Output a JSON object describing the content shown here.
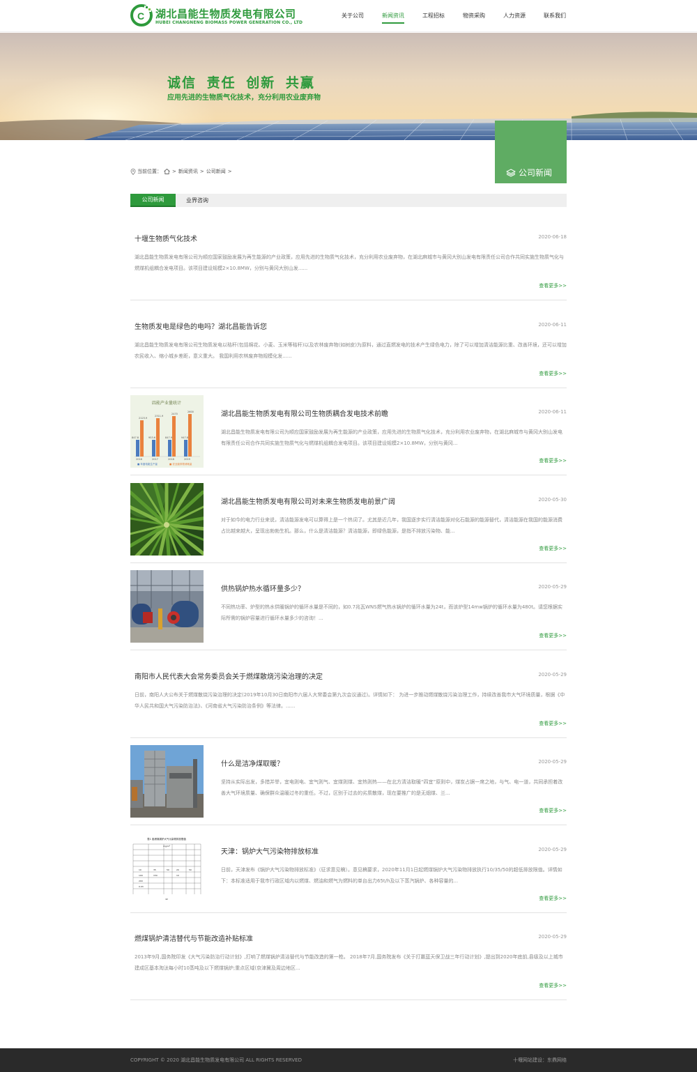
{
  "header": {
    "company_cn": "湖北昌能生物质发电有限公司",
    "company_en": "HUBEI CHANGNENG BIOMASS POWER GENERATION CO., LTD",
    "nav": [
      {
        "label": "关于公司",
        "active": false
      },
      {
        "label": "新闻资讯",
        "active": true
      },
      {
        "label": "工程招标",
        "active": false
      },
      {
        "label": "物资采购",
        "active": false
      },
      {
        "label": "人力资源",
        "active": false
      },
      {
        "label": "联系我们",
        "active": false
      }
    ]
  },
  "banner": {
    "slogan": "诚信 责任 创新 共赢",
    "subslogan": "应用先进的生物质气化技术，充分利用农业废弃物"
  },
  "section_badge": "公司新闻",
  "breadcrumb": {
    "prefix": "当前位置：",
    "sep": ">",
    "items": [
      "新闻资讯",
      "公司新闻"
    ]
  },
  "tabs": [
    {
      "label": "公司新闻",
      "active": true
    },
    {
      "label": "业界咨询",
      "active": false
    }
  ],
  "thumb_chart": {
    "title": "四能产业量统计",
    "series_a": [
      "2019",
      "2018",
      "2017",
      "2016"
    ],
    "labels": [
      "2123.9",
      "2311.9",
      "2470",
      "2600",
      "847.8",
      "953.6",
      "847.9",
      "947.8"
    ],
    "legend": [
      "■ 年度电能生产量",
      "■ 农业废弃物消耗量"
    ]
  },
  "thumb_table": {
    "title": "表1 各燃煤锅炉大气污染物排放限值",
    "unit": "mg/m³",
    "cell_values": [
      "10",
      "35",
      "50",
      "100",
      "150",
      "200",
      "0.03",
      "20",
      "10",
      "50"
    ]
  },
  "news": [
    {
      "title": "十堰生物质气化技术",
      "date": "2020-06-18",
      "desc": "湖北昌能生物质发电有限公司为顺应国家鼓励发展为再生能源的产业政策，应用先进的生物质气化技术，充分利用农业废弃物，在湖北麻城市与黄冈大别山发电有限责任公司合作共同实施生物质气化与燃煤机组耦合发电项目。该项目建设规模2×10.8MW，分别与黄冈大别山发......",
      "more": "查看更多>>",
      "thumb": null
    },
    {
      "title": "生物质发电是绿色的电吗？湖北昌能告诉您",
      "date": "2020-06-11",
      "desc": "湖北昌能生物质发电有限公司生物质发电以秸秆(包括棉花、小麦、玉米等秸秆)以及农林废弃物(如树皮)为原料，通过直燃发电的技术产生绿色电力，除了可以增加清洁能源比重、改善环境，还可以增加农民收入、缩小城乡差距，意义重大。 我国利用农林废弃物规模化发......",
      "more": "查看更多>>",
      "thumb": null
    },
    {
      "title": "湖北昌能生物质发电有限公司生物质耦合发电技术前瞻",
      "date": "2020-06-11",
      "desc": "湖北昌能生物质发电有限公司为顺应国家鼓励发展为再生能源的产业政策，应用先进的生物质气化技术，充分利用农业废弃物，在湖北麻城市与黄冈大别山发电有限责任公司合作共同实施生物质气化与燃煤机组耦合发电项目。该项目建设规模2×10.8MW，分别与黄冈...",
      "more": "查看更多>>",
      "thumb": "chart"
    },
    {
      "title": "湖北昌能生物质发电有限公司对未来生物质发电前景广阔",
      "date": "2020-05-30",
      "desc": "对于如今的电力行业来说，清洁能源发电可以算得上是一个热词了。尤其是近几年，我国逐步实行清洁能源对化石能源的能源替代，清洁能源在我国的能源消费占比越来越大，呈现出勃勃生机。那么，什么是清洁能源？清洁能源，即绿色能源，是指不排放污染物、能...",
      "more": "查看更多>>",
      "thumb": "palm"
    },
    {
      "title": "供热锅炉热水循环量多少？",
      "date": "2020-05-29",
      "desc": "不同热功率、炉型的热水供暖锅炉的循环水量是不同的，如0.7兆瓦WNS燃气热水锅炉的循环水量为24t，而该炉型14mw锅炉的循环水量为480t。请您根据实际所需的锅炉容量进行循环水量多少的咨询！...",
      "more": "查看更多>>",
      "thumb": "boiler"
    },
    {
      "title": "南阳市人民代表大会常务委员会关于燃煤散烧污染治理的决定",
      "date": "2020-05-29",
      "desc": "日前，南阳人大公布关于燃煤散烧污染治理的决定(2019年10月30日南阳市六届人大常委会第九次会议通过)。详情如下： 为进一步推动燃煤散烧污染治理工作，持续改善我市大气环境质量，根据《中华人民共和国大气污染防治法》、《河南省大气污染防治条例》等法律。......",
      "more": "查看更多>>",
      "thumb": null
    },
    {
      "title": "什么是洁净煤取暖？",
      "date": "2020-05-29",
      "desc": "坚持从实际出发，多措并举，宜电则电、宜气则气、宜煤则煤、宜热则热——在北方清洁取暖“四宜”原则中，煤炭占据一席之地，与气、电一道，共同承担着改善大气环境质量、确保群众温暖过冬的重任。不过，区别于过去的劣质散煤，现在要推广的是无烟煤、兰...",
      "more": "查看更多>>",
      "thumb": "plant"
    },
    {
      "title": "天津：锅炉大气污染物排放标准",
      "date": "2020-05-29",
      "desc": "日前，天津发布《锅炉大气污染物排放标准》（征求意见稿）。意见稿要求，2020年11月1日起燃煤锅炉大气污染物排放执行10/35/50的超低排放限值。详情如下：本标准适用于我市行政区域内以燃煤、燃油和燃气为燃料的单台出力65t/h及以下蒸汽锅炉、各种容量的...",
      "more": "查看更多>>",
      "thumb": "table"
    },
    {
      "title": "燃煤锅炉清洁替代与节能改造补贴标准",
      "date": "2020-05-29",
      "desc": "2013年9月,国务院印发《大气污染防治行动计划》,打响了燃煤锅炉清洁替代与节能改造的第一枪。 2018年7月,国务院发布《关于打赢蓝天保卫战三年行动计划》,提出到2020年底前,县级及以上城市建成区基本淘汰每小时10蒸吨及以下燃煤锅炉;重点区域(京津冀及周边地区...",
      "more": "查看更多>>",
      "thumb": null
    }
  ],
  "footer": {
    "copyright": "COPYRIGHT © 2020 湖北昌能生物质发电有限公司 ALL RIGHTS RESERVED",
    "credit": "十堰网站建设：东鼎网络"
  },
  "colors": {
    "brand_green": "#2e9a3c",
    "badge_green": "#5fac63",
    "footer_bg": "#2a2a2a"
  }
}
